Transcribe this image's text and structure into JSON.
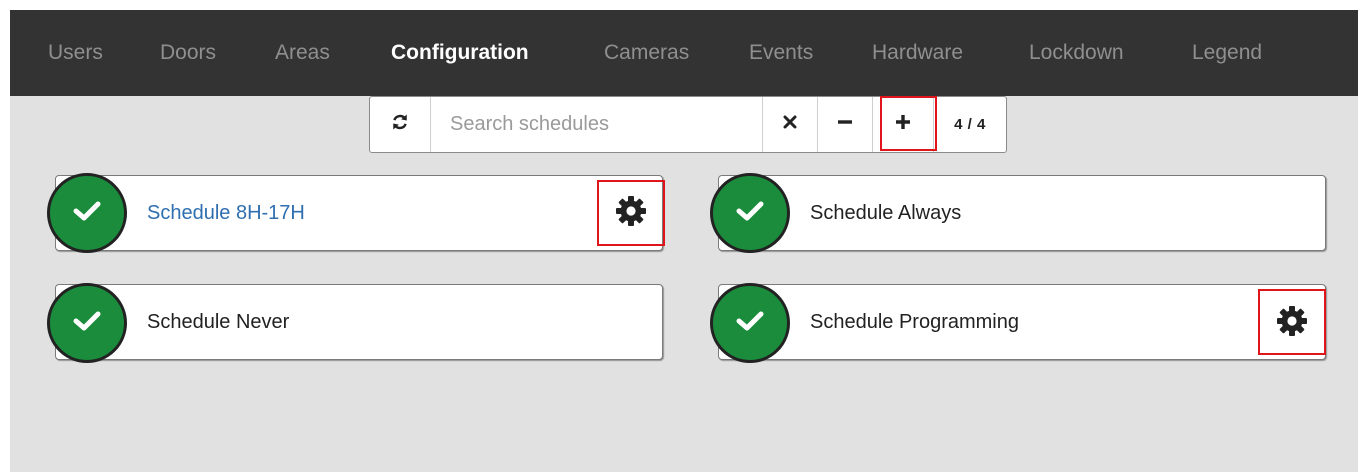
{
  "nav": {
    "items": [
      {
        "label": "Users",
        "active": false
      },
      {
        "label": "Doors",
        "active": false
      },
      {
        "label": "Areas",
        "active": false
      },
      {
        "label": "Configuration",
        "active": true
      },
      {
        "label": "Cameras",
        "active": false
      },
      {
        "label": "Events",
        "active": false
      },
      {
        "label": "Hardware",
        "active": false
      },
      {
        "label": "Lockdown",
        "active": false
      },
      {
        "label": "Legend",
        "active": false
      }
    ]
  },
  "toolbar": {
    "refresh_icon": "refresh-icon",
    "search_placeholder": "Search schedules",
    "search_value": "",
    "clear_symbol": "×",
    "collapse_symbol": "−",
    "add_symbol": "+",
    "count": "4 / 4"
  },
  "schedules": [
    {
      "name": "Schedule 8H-17H",
      "status": "enabled",
      "has_settings": true,
      "is_link": true
    },
    {
      "name": "Schedule Always",
      "status": "enabled",
      "has_settings": false,
      "is_link": false
    },
    {
      "name": "Schedule Never",
      "status": "enabled",
      "has_settings": false,
      "is_link": false
    },
    {
      "name": "Schedule Programming",
      "status": "enabled",
      "has_settings": true,
      "is_link": false
    }
  ],
  "colors": {
    "nav_bg": "#333333",
    "nav_active": "#ffffff",
    "nav_inactive": "#8f8f8f",
    "status_green": "#1a8c3c",
    "highlight_red": "#e0151b",
    "link_blue": "#2f6fb0"
  }
}
